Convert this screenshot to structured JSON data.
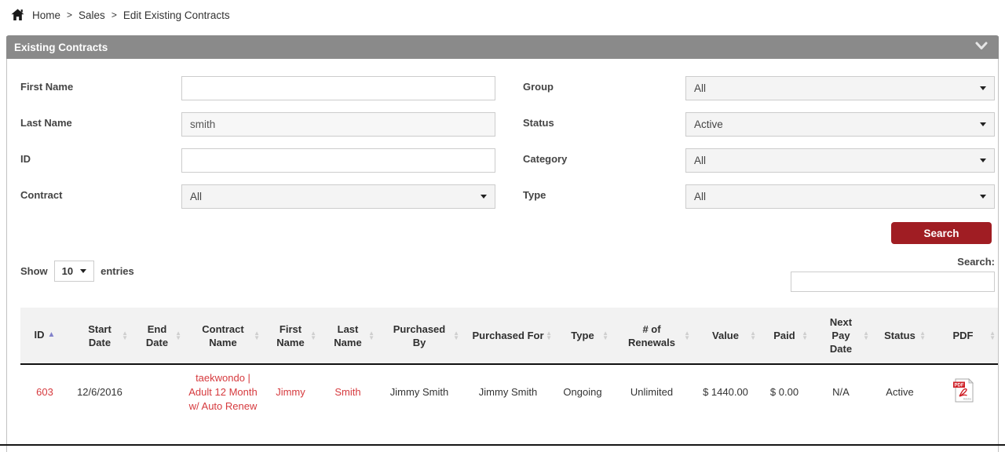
{
  "breadcrumb": {
    "items": [
      "Home",
      "Sales",
      "Edit Existing Contracts"
    ],
    "separator": ">"
  },
  "panel": {
    "title": "Existing Contracts"
  },
  "filters": {
    "first_name": {
      "label": "First Name",
      "value": ""
    },
    "last_name": {
      "label": "Last Name",
      "value": "smith"
    },
    "id": {
      "label": "ID",
      "value": ""
    },
    "contract": {
      "label": "Contract",
      "value": "All"
    },
    "group": {
      "label": "Group",
      "value": "All"
    },
    "status": {
      "label": "Status",
      "value": "Active"
    },
    "category": {
      "label": "Category",
      "value": "All"
    },
    "type": {
      "label": "Type",
      "value": "All"
    },
    "search_button_label": "Search"
  },
  "table_controls": {
    "show_label": "Show",
    "page_size": "10",
    "entries_label": "entries",
    "search_label": "Search:",
    "search_value": ""
  },
  "table": {
    "columns": [
      {
        "label": "ID",
        "sort": "asc"
      },
      {
        "label": "Start Date",
        "sort": "none"
      },
      {
        "label": "End Date",
        "sort": "none"
      },
      {
        "label": "Contract Name",
        "sort": "none"
      },
      {
        "label": "First Name",
        "sort": "none"
      },
      {
        "label": "Last Name",
        "sort": "none"
      },
      {
        "label": "Purchased By",
        "sort": "none"
      },
      {
        "label": "Purchased For",
        "sort": "none"
      },
      {
        "label": "Type",
        "sort": "none"
      },
      {
        "label": "# of Renewals",
        "sort": "none"
      },
      {
        "label": "Value",
        "sort": "none"
      },
      {
        "label": "Paid",
        "sort": "none"
      },
      {
        "label": "Next Pay Date",
        "sort": "none"
      },
      {
        "label": "Status",
        "sort": "none"
      },
      {
        "label": "PDF",
        "sort": "none"
      }
    ],
    "row": {
      "id": "603",
      "start_date": "12/6/2016",
      "end_date": "",
      "contract_name": "taekwondo | Adult 12 Month w/ Auto Renew",
      "first_name": "Jimmy",
      "last_name": "Smith",
      "purchased_by": "Jimmy Smith",
      "purchased_for": "Jimmy Smith",
      "type": "Ongoing",
      "renewals": "Unlimited",
      "value": "$ 1440.00",
      "paid": "$ 0.00",
      "next_pay_date": "N/A",
      "status": "Active",
      "pdf_icon": "pdf-file-icon"
    }
  },
  "colors": {
    "accent_red": "#a01d23",
    "link_red": "#d63a3e",
    "panel_header_gray": "#8a8a8a"
  }
}
